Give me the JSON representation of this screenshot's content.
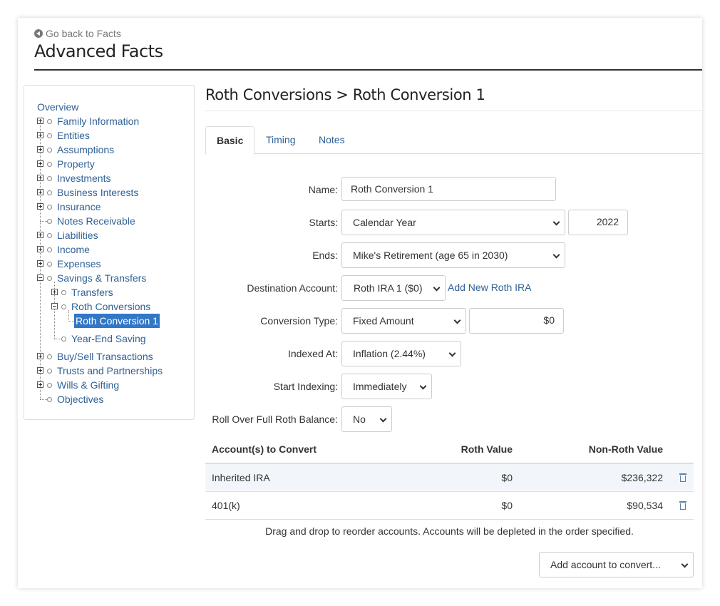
{
  "header": {
    "back_link": "Go back to Facts",
    "title": "Advanced Facts"
  },
  "sidebar": {
    "overview": "Overview",
    "items": {
      "family": "Family Information",
      "entities": "Entities",
      "assumptions": "Assumptions",
      "property": "Property",
      "investments": "Investments",
      "business": "Business Interests",
      "insurance": "Insurance",
      "notes_receivable": "Notes Receivable",
      "liabilities": "Liabilities",
      "income": "Income",
      "expenses": "Expenses",
      "savings": "Savings & Transfers",
      "transfers": "Transfers",
      "roth_conversions": "Roth Conversions",
      "roth_conversion_1": "Roth Conversion 1",
      "year_end": "Year-End Saving",
      "buy_sell": "Buy/Sell Transactions",
      "trusts": "Trusts and Partnerships",
      "wills": "Wills & Gifting",
      "objectives": "Objectives"
    }
  },
  "main": {
    "heading": "Roth Conversions > Roth Conversion 1",
    "tabs": [
      "Basic",
      "Timing",
      "Notes"
    ],
    "active_tab": "Basic"
  },
  "form": {
    "name_label": "Name:",
    "name_value": "Roth Conversion 1",
    "starts_label": "Starts:",
    "starts_value": "Calendar Year",
    "starts_year": "2022",
    "ends_label": "Ends:",
    "ends_value": "Mike's Retirement (age 65 in 2030)",
    "dest_label": "Destination Account:",
    "dest_value": "Roth IRA 1 ($0)",
    "add_roth_link": "Add New Roth IRA",
    "conv_type_label": "Conversion Type:",
    "conv_type_value": "Fixed Amount",
    "conv_amount": "$0",
    "indexed_label": "Indexed At:",
    "indexed_value": "Inflation (2.44%)",
    "start_indexing_label": "Start Indexing:",
    "start_indexing_value": "Immediately",
    "rollover_label": "Roll Over Full Roth Balance:",
    "rollover_value": "No"
  },
  "accounts_table": {
    "headers": {
      "account": "Account(s) to Convert",
      "roth": "Roth Value",
      "non_roth": "Non-Roth Value"
    },
    "rows": [
      {
        "account": "Inherited IRA",
        "roth": "$0",
        "non_roth": "$236,322"
      },
      {
        "account": "401(k)",
        "roth": "$0",
        "non_roth": "$90,534"
      }
    ],
    "hint": "Drag and drop to reorder accounts. Accounts will be depleted in the order specified.",
    "add_account": "Add account to convert..."
  },
  "colors": {
    "link": "#2f6196",
    "selected": "#3277c6",
    "row_highlight": "#f2f6fa"
  }
}
